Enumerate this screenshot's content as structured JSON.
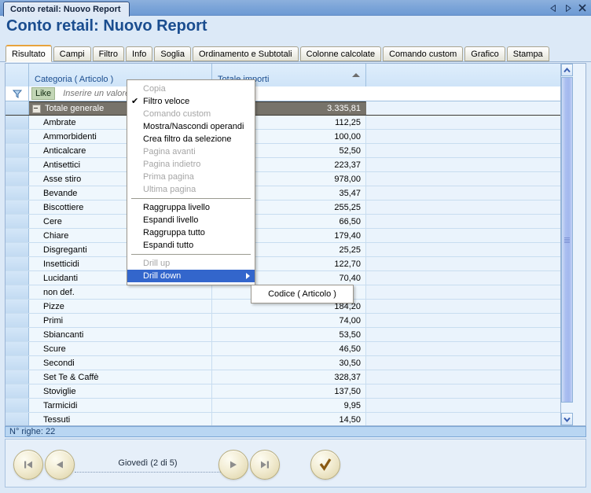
{
  "window": {
    "tab_title": "Conto retail: Nuovo Report",
    "controls": {
      "prev": "prev-arrow",
      "next": "next-arrow",
      "close": "close-x"
    }
  },
  "header": {
    "title": "Conto retail: Nuovo Report"
  },
  "tabs": [
    {
      "label": "Risultato",
      "active": true
    },
    {
      "label": "Campi",
      "active": false
    },
    {
      "label": "Filtro",
      "active": false
    },
    {
      "label": "Info",
      "active": false
    },
    {
      "label": "Soglia",
      "active": false
    },
    {
      "label": "Ordinamento e Subtotali",
      "active": false
    },
    {
      "label": "Colonne calcolate",
      "active": false
    },
    {
      "label": "Comando custom",
      "active": false
    },
    {
      "label": "Grafico",
      "active": false
    },
    {
      "label": "Stampa",
      "active": false
    }
  ],
  "grid": {
    "columns": [
      {
        "label": "Categoria ( Articolo )",
        "sorted": false
      },
      {
        "label": "Totale importi",
        "sorted": true
      }
    ],
    "filter": {
      "operator": "Like",
      "placeholder": "Inserire un valore per filtrare",
      "value": "",
      "icon": "funnel-icon"
    },
    "total_row": {
      "category": "Totale generale",
      "value": "3.335,81"
    },
    "rows": [
      {
        "category": "Ambrate",
        "value": "112,25"
      },
      {
        "category": "Ammorbidenti",
        "value": "100,00"
      },
      {
        "category": "Anticalcare",
        "value": "52,50"
      },
      {
        "category": "Antisettici",
        "value": "223,37"
      },
      {
        "category": "Asse stiro",
        "value": "978,00"
      },
      {
        "category": "Bevande",
        "value": "35,47"
      },
      {
        "category": "Biscottiere",
        "value": "255,25"
      },
      {
        "category": "Cere",
        "value": "66,50"
      },
      {
        "category": "Chiare",
        "value": "179,40"
      },
      {
        "category": "Disgreganti",
        "value": "25,25"
      },
      {
        "category": "Insetticidi",
        "value": "122,70"
      },
      {
        "category": "Lucidanti",
        "value": "70,40"
      },
      {
        "category": "non def.",
        "value": ""
      },
      {
        "category": "Pizze",
        "value": "184,20"
      },
      {
        "category": "Primi",
        "value": "74,00"
      },
      {
        "category": "Sbiancanti",
        "value": "53,50"
      },
      {
        "category": "Scure",
        "value": "46,50"
      },
      {
        "category": "Secondi",
        "value": "30,50"
      },
      {
        "category": "Set Te & Caffè",
        "value": "328,37"
      },
      {
        "category": "Stoviglie",
        "value": "137,50"
      },
      {
        "category": "Tarmicidi",
        "value": "9,95"
      },
      {
        "category": "Tessuti",
        "value": "14,50"
      }
    ]
  },
  "status": {
    "text": "N° righe: 22"
  },
  "nav": {
    "label": "Giovedì (2 di 5)",
    "first": "first-page-icon",
    "prev": "previous-page-icon",
    "next": "next-page-icon",
    "last": "last-page-icon",
    "confirm": "confirm-check-icon"
  },
  "context_menu": {
    "items": [
      {
        "label": "Copia",
        "disabled": true,
        "checked": false,
        "separator_after": false
      },
      {
        "label": "Filtro veloce",
        "disabled": false,
        "checked": true,
        "separator_after": false
      },
      {
        "label": "Comando custom",
        "disabled": true,
        "checked": false,
        "separator_after": false
      },
      {
        "label": "Mostra/Nascondi operandi",
        "disabled": false,
        "checked": false,
        "separator_after": false
      },
      {
        "label": "Crea filtro da selezione",
        "disabled": false,
        "checked": false,
        "separator_after": false
      },
      {
        "label": "Pagina avanti",
        "disabled": true,
        "checked": false,
        "separator_after": false
      },
      {
        "label": "Pagina indietro",
        "disabled": true,
        "checked": false,
        "separator_after": false
      },
      {
        "label": "Prima pagina",
        "disabled": true,
        "checked": false,
        "separator_after": false
      },
      {
        "label": "Ultima pagina",
        "disabled": true,
        "checked": false,
        "separator_after": true
      },
      {
        "label": "Raggruppa livello",
        "disabled": false,
        "checked": false,
        "separator_after": false
      },
      {
        "label": "Espandi livello",
        "disabled": false,
        "checked": false,
        "separator_after": false
      },
      {
        "label": "Raggruppa tutto",
        "disabled": false,
        "checked": false,
        "separator_after": false
      },
      {
        "label": "Espandi tutto",
        "disabled": false,
        "checked": false,
        "separator_after": true
      },
      {
        "label": "Drill up",
        "disabled": true,
        "checked": false,
        "separator_after": false
      },
      {
        "label": "Drill down",
        "disabled": false,
        "checked": false,
        "highlight": true,
        "submenu": true,
        "separator_after": false
      }
    ],
    "submenu": {
      "items": [
        {
          "label": "Codice ( Articolo )"
        }
      ]
    }
  },
  "colors": {
    "accent": "#1a4d8f",
    "titlebar": "#7ba4d8",
    "active_tab_underline": "#e8a33d",
    "total_row_bg": "#77736a",
    "menu_highlight": "#3366cc",
    "status_bg": "#b9d6f2"
  }
}
